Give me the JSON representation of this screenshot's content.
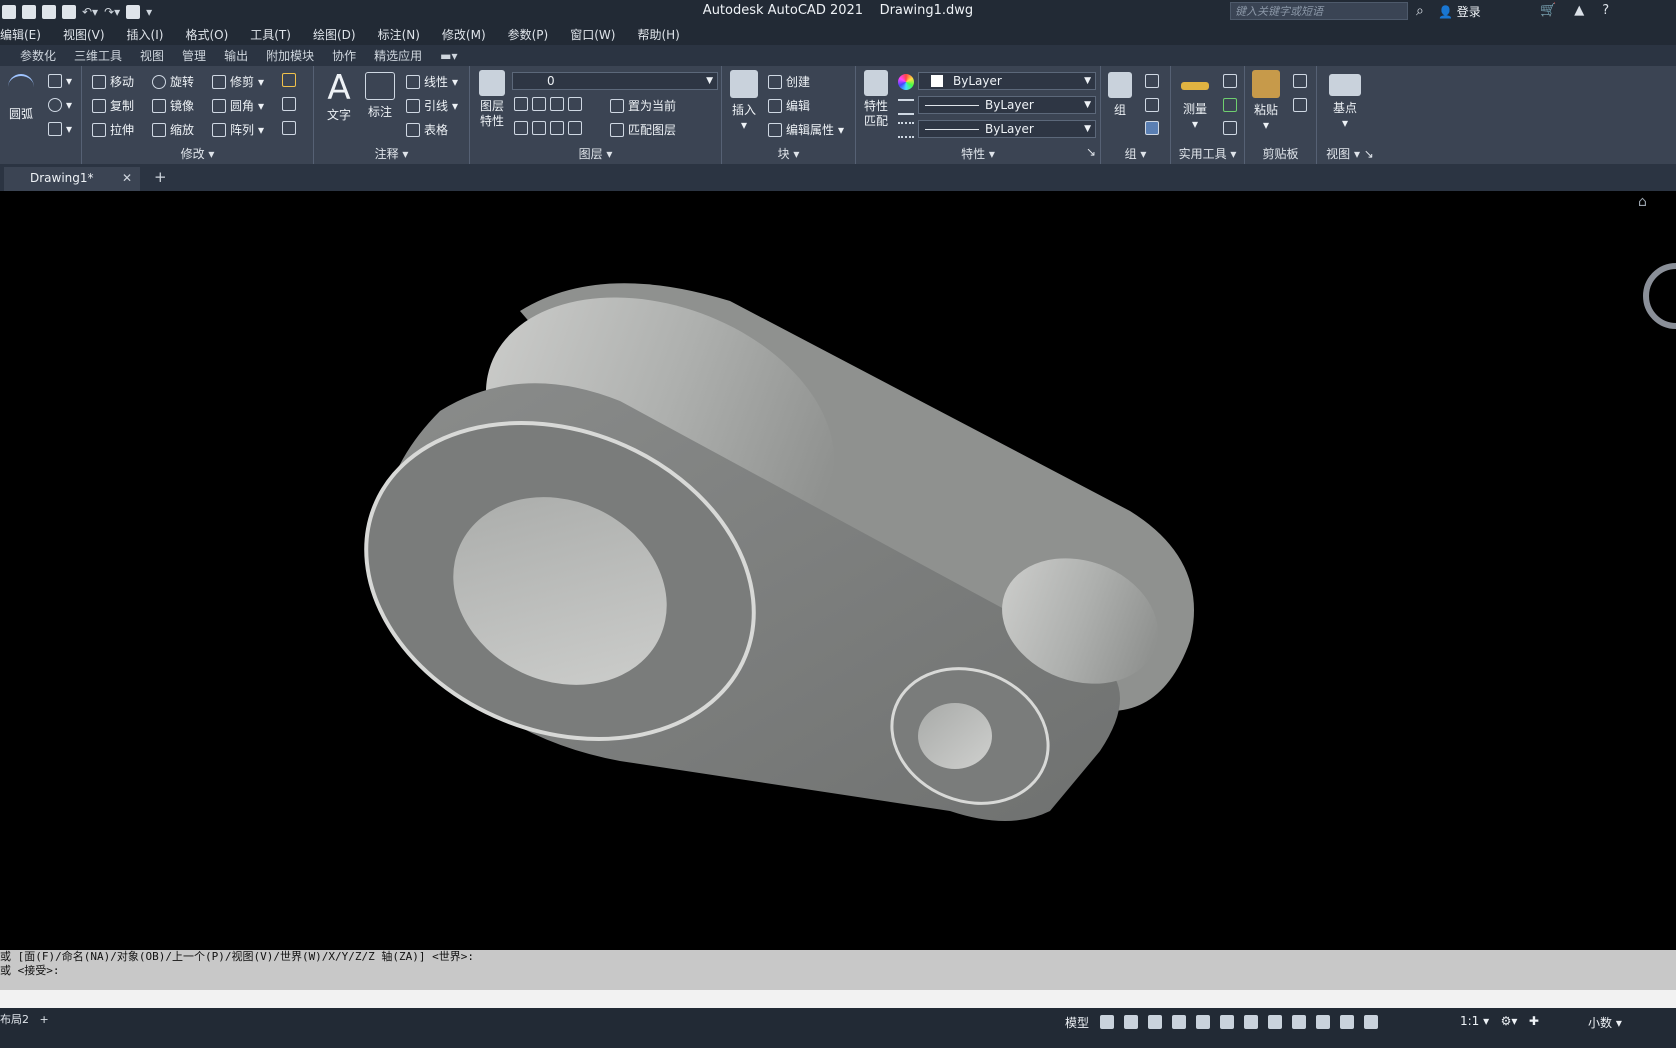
{
  "title": {
    "app": "Autodesk AutoCAD 2021",
    "file": "Drawing1.dwg",
    "search_placeholder": "键入关键字或短语",
    "login": "登录"
  },
  "menus": [
    "编辑(E)",
    "视图(V)",
    "插入(I)",
    "格式(O)",
    "工具(T)",
    "绘图(D)",
    "标注(N)",
    "修改(M)",
    "参数(P)",
    "窗口(W)",
    "帮助(H)"
  ],
  "ribbon_tabs": [
    "参数化",
    "三维工具",
    "视图",
    "管理",
    "输出",
    "附加模块",
    "协作",
    "精选应用"
  ],
  "ribbon": {
    "draw": {
      "arc": "圆弧"
    },
    "modify": {
      "title": "修改",
      "move": "移动",
      "rotate": "旋转",
      "trim": "修剪",
      "copy": "复制",
      "mirror": "镜像",
      "fillet": "圆角",
      "stretch": "拉伸",
      "scale": "缩放",
      "array": "阵列"
    },
    "annotation": {
      "title": "注释",
      "text": "文字",
      "dimension": "标注",
      "linear": "线性",
      "leader": "引线",
      "table": "表格"
    },
    "layers": {
      "title": "图层",
      "layer_props": "图层特性",
      "layer_value": "0",
      "set_current": "置为当前",
      "match_layer": "匹配图层"
    },
    "block": {
      "title": "块",
      "insert": "插入",
      "create": "创建",
      "edit": "编辑",
      "edit_attr": "编辑属性"
    },
    "properties": {
      "title": "特性",
      "match": "特性匹配",
      "color": "ByLayer",
      "linetype": "ByLayer",
      "lineweight": "ByLayer"
    },
    "groups": {
      "title": "组",
      "group": "组"
    },
    "utilities": {
      "title": "实用工具",
      "measure": "测量"
    },
    "clipboard": {
      "title": "剪贴板",
      "paste": "粘贴"
    },
    "view": {
      "title": "视图",
      "base": "基点"
    }
  },
  "doc_tab": {
    "name": "Drawing1*"
  },
  "command": {
    "line1": "或 [面(F)/命名(NA)/对象(OB)/上一个(P)/视图(V)/世界(W)/X/Y/Z/Z 轴(ZA)] <世界>:",
    "line2": "或 <接受>:"
  },
  "status": {
    "layout": "布局2",
    "model": "模型",
    "scale": "1:1",
    "units": "小数"
  }
}
